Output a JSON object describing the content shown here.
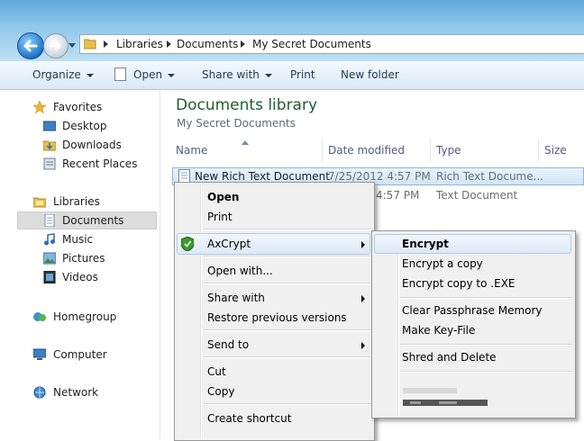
{
  "address_bar": {
    "breadcrumbs": [
      "Libraries",
      "Documents",
      "My Secret Documents"
    ]
  },
  "toolbar": {
    "organize": "Organize",
    "open": "Open",
    "share_with": "Share with",
    "print": "Print",
    "new_folder": "New folder"
  },
  "nav": {
    "favorites": "Favorites",
    "desktop": "Desktop",
    "downloads": "Downloads",
    "recent_places": "Recent Places",
    "libraries": "Libraries",
    "documents": "Documents",
    "music": "Music",
    "pictures": "Pictures",
    "videos": "Videos",
    "homegroup": "Homegroup",
    "computer": "Computer",
    "network": "Network"
  },
  "library": {
    "title": "Documents library",
    "subtitle": "My Secret Documents"
  },
  "columns": {
    "name": "Name",
    "date_modified": "Date modified",
    "type": "Type",
    "size": "Size"
  },
  "files": [
    {
      "name": "New Rich Text Document",
      "date": "7/25/2012 4:57 PM",
      "type": "Rich Text Docume..."
    },
    {
      "date": "4:57 PM",
      "type": "Text Document"
    }
  ],
  "context_menu": {
    "open": "Open",
    "print": "Print",
    "axcrypt": "AxCrypt",
    "open_with": "Open with...",
    "share_with": "Share with",
    "restore_previous_versions": "Restore previous versions",
    "send_to": "Send to",
    "cut": "Cut",
    "copy": "Copy",
    "create_shortcut": "Create shortcut"
  },
  "axcrypt_submenu": {
    "encrypt": "Encrypt",
    "encrypt_copy": "Encrypt a copy",
    "encrypt_copy_exe": "Encrypt copy to .EXE",
    "clear_passphrase_memory": "Clear Passphrase Memory",
    "make_key_file": "Make Key-File",
    "shred_and_delete": "Shred and Delete"
  }
}
